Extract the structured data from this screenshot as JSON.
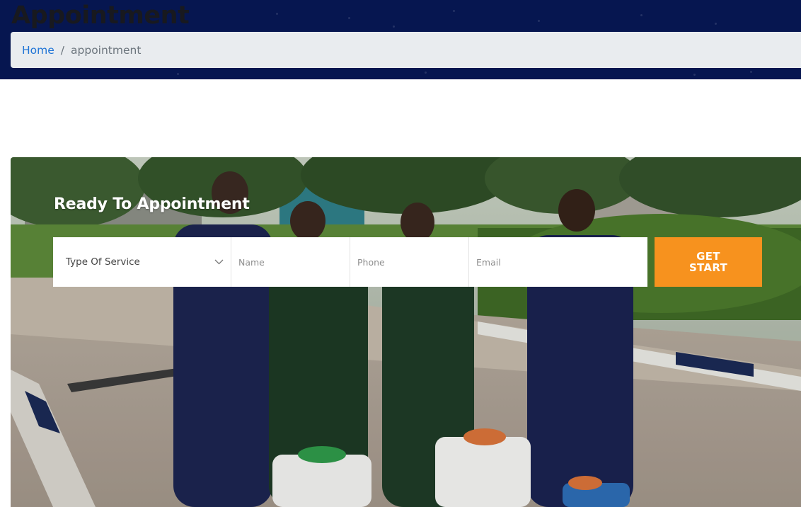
{
  "header": {
    "title": "Appointment",
    "breadcrumb": {
      "home": "Home",
      "separator": "/",
      "current": "appointment"
    }
  },
  "appointment": {
    "heading": "Ready To Appointment",
    "service_select": {
      "selected": "Type Of Service",
      "icon": "chevron-down-icon"
    },
    "name_placeholder": "Name",
    "phone_placeholder": "Phone",
    "email_placeholder": "Email",
    "submit_label": "GET START"
  },
  "colors": {
    "header_bg": "#061650",
    "breadcrumb_bg": "#e9ecef",
    "link": "#1f74d6",
    "accent": "#f7921e"
  }
}
